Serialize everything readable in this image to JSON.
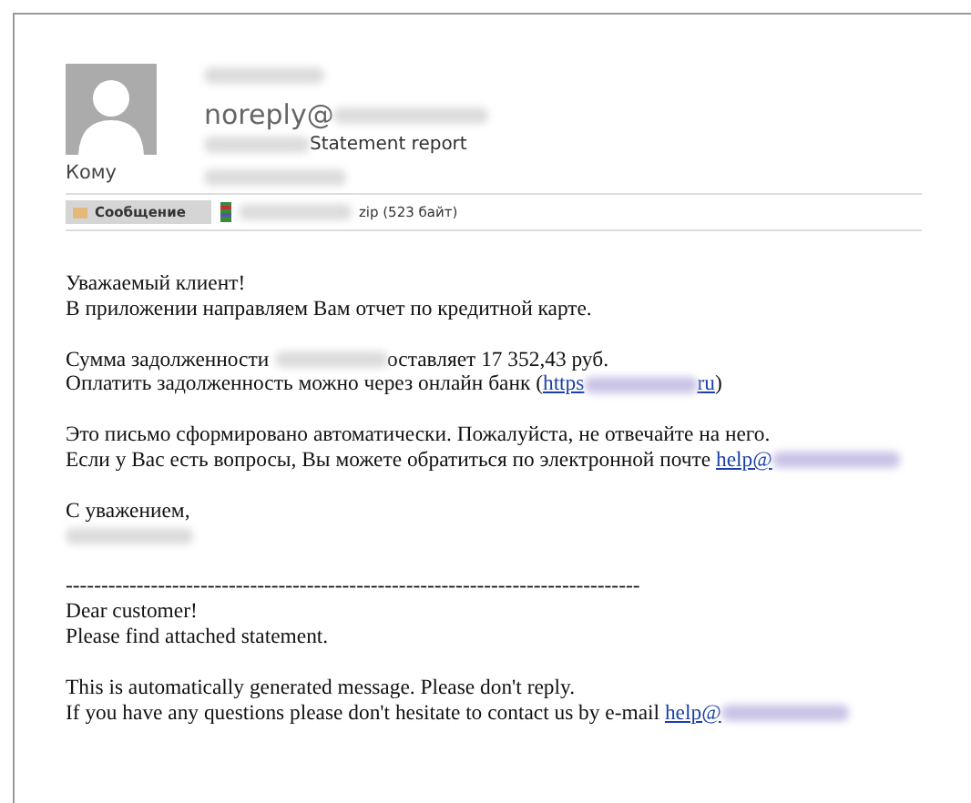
{
  "header": {
    "from_prefix": "noreply@",
    "subject": "Statement report",
    "to_label": "Кому"
  },
  "attachments": [
    {
      "kind": "tab",
      "label": "Сообщение",
      "selected": true
    },
    {
      "kind": "file",
      "label": "zip (523 байт)",
      "selected": false
    }
  ],
  "body": [
    [
      [
        {
          "kind": "text",
          "text": "Уважаемый клиент!"
        }
      ],
      [
        {
          "kind": "text",
          "text": "В приложении направляем Вам отчет по кредитной карте."
        }
      ]
    ],
    [
      [
        {
          "kind": "text",
          "text": "Сумма задолженности "
        },
        {
          "kind": "blur"
        },
        {
          "kind": "text",
          "text": "оставляет 17 352,43 руб."
        }
      ],
      [
        {
          "kind": "text",
          "text": "Оплатить задолженность можно через онлайн банк ("
        },
        {
          "kind": "link",
          "text": "https"
        },
        {
          "kind": "blur"
        },
        {
          "kind": "link",
          "text": "ru"
        },
        {
          "kind": "text",
          "text": ")"
        }
      ]
    ],
    [
      [
        {
          "kind": "text",
          "text": "Это письмо сформировано автоматически. Пожалуйста, не отвечайте на него."
        }
      ],
      [
        {
          "kind": "text",
          "text": "Если у Вас есть вопросы, Вы можете обратиться по электронной почте "
        },
        {
          "kind": "link",
          "text": "help@"
        },
        {
          "kind": "wide-blur"
        }
      ]
    ],
    [
      [
        {
          "kind": "text",
          "text": "С уважением,"
        }
      ],
      [
        {
          "kind": "wide-blur"
        }
      ]
    ],
    [
      [
        {
          "kind": "text",
          "text": "---------------------------------------------------------------------------------"
        }
      ],
      [
        {
          "kind": "text",
          "text": "Dear customer!"
        }
      ],
      [
        {
          "kind": "text",
          "text": "Please find attached statement."
        }
      ]
    ],
    [
      [
        {
          "kind": "text",
          "text": "This is automatically generated message. Please don't reply."
        }
      ],
      [
        {
          "kind": "text",
          "text": "If you have any questions please don't hesitate to contact us by e-mail "
        },
        {
          "kind": "link",
          "text": "help@"
        },
        {
          "kind": "wide-blur"
        }
      ]
    ]
  ]
}
